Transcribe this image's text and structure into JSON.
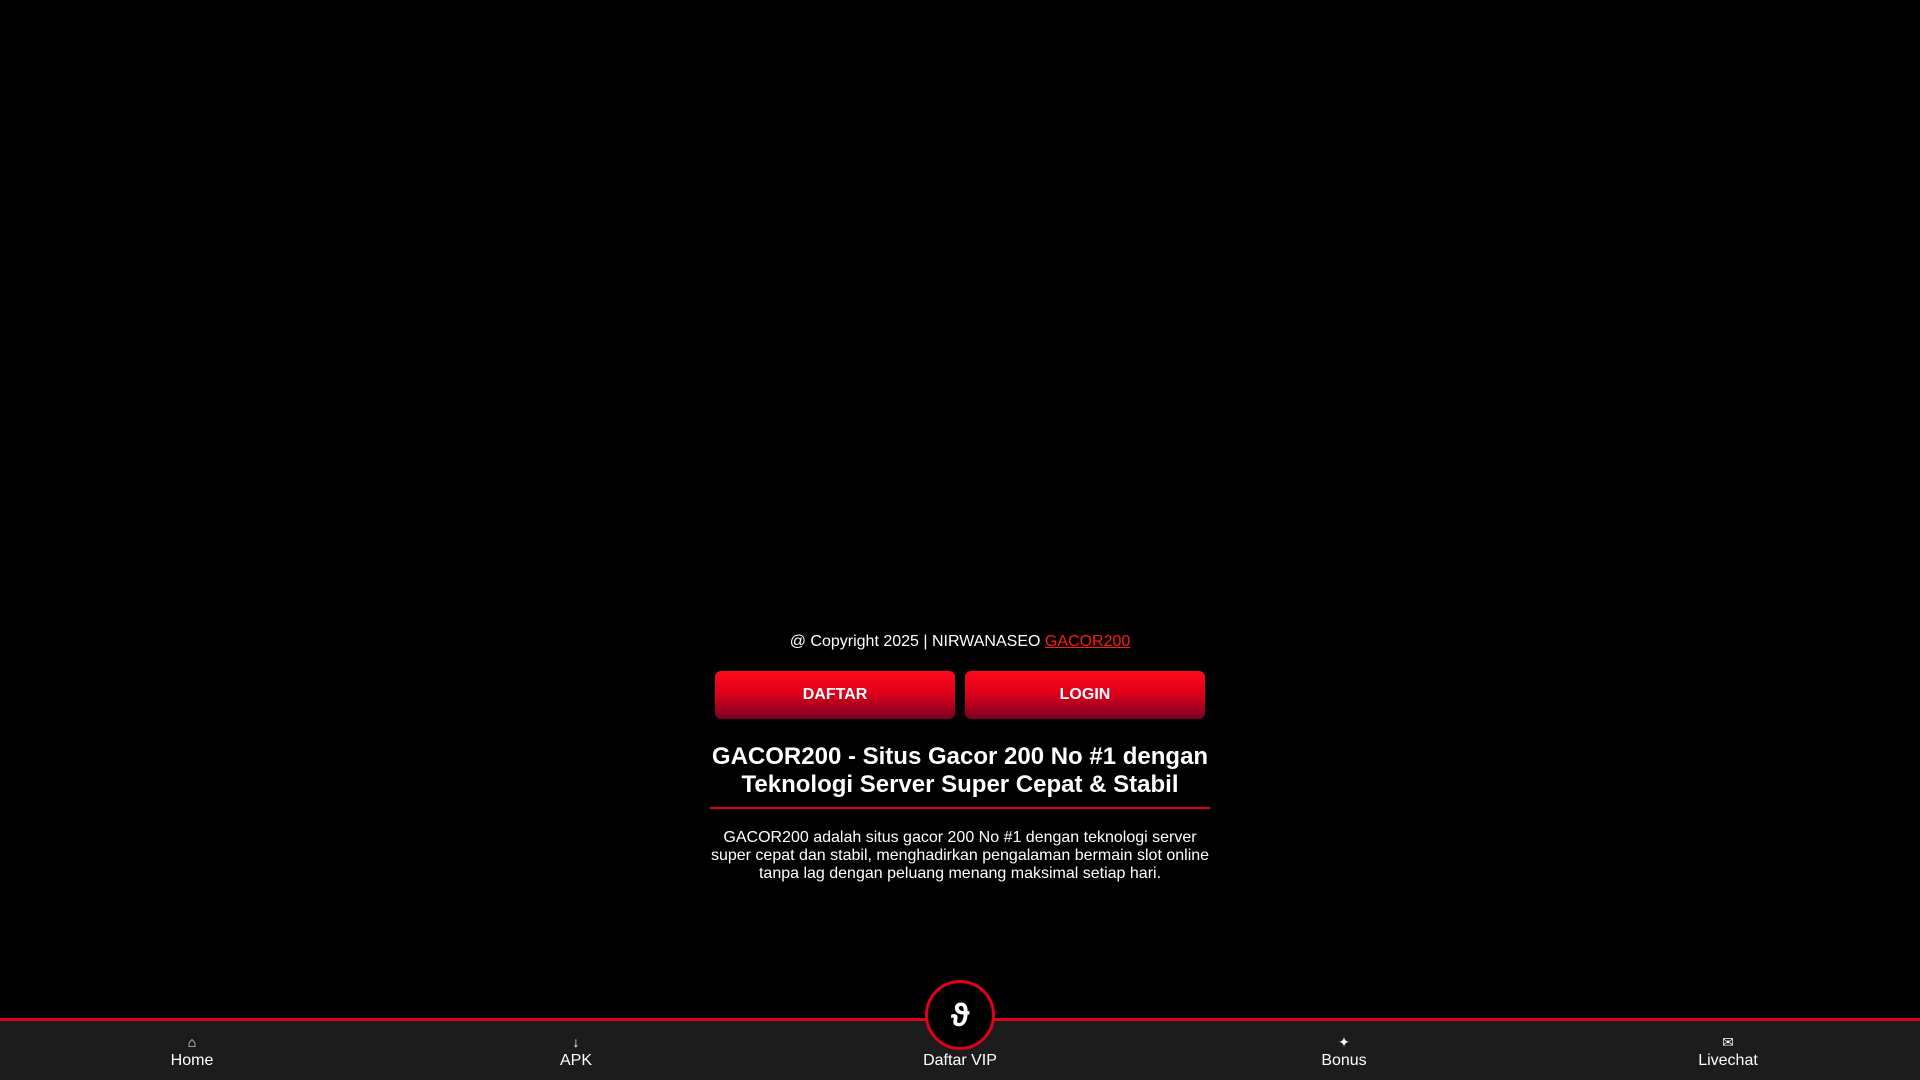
{
  "footer": {
    "copyright_prefix": "@ Copyright 2025 | NIRWANASEO ",
    "copyright_link": "GACOR200"
  },
  "buttons": {
    "daftar": "DAFTAR",
    "login": "LOGIN"
  },
  "article": {
    "headline_line1": "GACOR200 - Situs Gacor 200 No #1 dengan",
    "headline_line2": "Teknologi Server Super Cepat & Stabil",
    "description": "GACOR200 adalah situs gacor 200 No #1 dengan teknologi server super cepat dan stabil, menghadirkan pengalaman bermain slot online tanpa lag dengan peluang menang maksimal setiap hari."
  },
  "bottom_nav": {
    "items": [
      {
        "label": "Home",
        "icon": "home-icon",
        "glyph": "⌂"
      },
      {
        "label": "APK",
        "icon": "download-icon",
        "glyph": "↓"
      },
      {
        "label": "Daftar VIP",
        "icon": "vip-icon",
        "glyph": "ϑ"
      },
      {
        "label": "Bonus",
        "icon": "gift-icon",
        "glyph": "✦"
      },
      {
        "label": "Livechat",
        "icon": "chat-icon",
        "glyph": "✉"
      }
    ]
  },
  "colors": {
    "background": "#000000",
    "accent_red": "#e1001a",
    "link_red": "#ff1a1a",
    "nav_bg": "#1c1c1c"
  }
}
